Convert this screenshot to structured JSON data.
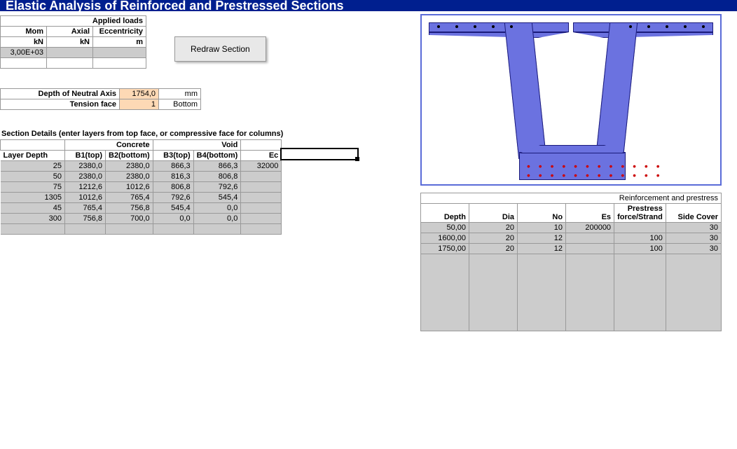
{
  "banner": "Elastic Analysis of Reinforced and Prestressed Sections",
  "applied_loads": {
    "title": "Applied loads",
    "headers": [
      "Mom",
      "Axial",
      "Eccentricity"
    ],
    "units": [
      "kN",
      "kN",
      "m"
    ],
    "row1": [
      "3,00E+03",
      "",
      ""
    ]
  },
  "redraw_label": "Redraw  Section",
  "neutral_axis": {
    "label": "Depth of Neutral Axis",
    "value": "1754,0",
    "unit": "mm"
  },
  "tension_face": {
    "label": "Tension face",
    "value": "1",
    "side": "Bottom"
  },
  "section_details": {
    "title": "Section Details (enter layers from top face, or compressive face for columns)",
    "group_concrete": "Concrete",
    "group_void": "Void",
    "headers": [
      "Layer Depth",
      "B1(top)",
      "B2(bottom)",
      "B3(top)",
      "B4(bottom)",
      "Ec"
    ],
    "rows": [
      [
        "25",
        "2380,0",
        "2380,0",
        "866,3",
        "866,3",
        "32000"
      ],
      [
        "50",
        "2380,0",
        "2380,0",
        "816,3",
        "806,8",
        ""
      ],
      [
        "75",
        "1212,6",
        "1012,6",
        "806,8",
        "792,6",
        ""
      ],
      [
        "1305",
        "1012,6",
        "765,4",
        "792,6",
        "545,4",
        ""
      ],
      [
        "45",
        "765,4",
        "756,8",
        "545,4",
        "0,0",
        ""
      ],
      [
        "300",
        "756,8",
        "700,0",
        "0,0",
        "0,0",
        ""
      ]
    ]
  },
  "reinforcement": {
    "title": "Reinforcement and prestress",
    "headers": [
      "Depth",
      "Dia",
      "No",
      "Es",
      "Prestress force/Strand",
      "Side Cover"
    ],
    "rows": [
      [
        "50,00",
        "20",
        "10",
        "200000",
        "",
        "30"
      ],
      [
        "1600,00",
        "20",
        "12",
        "",
        "100",
        "30"
      ],
      [
        "1750,00",
        "20",
        "12",
        "",
        "100",
        "30"
      ]
    ]
  }
}
